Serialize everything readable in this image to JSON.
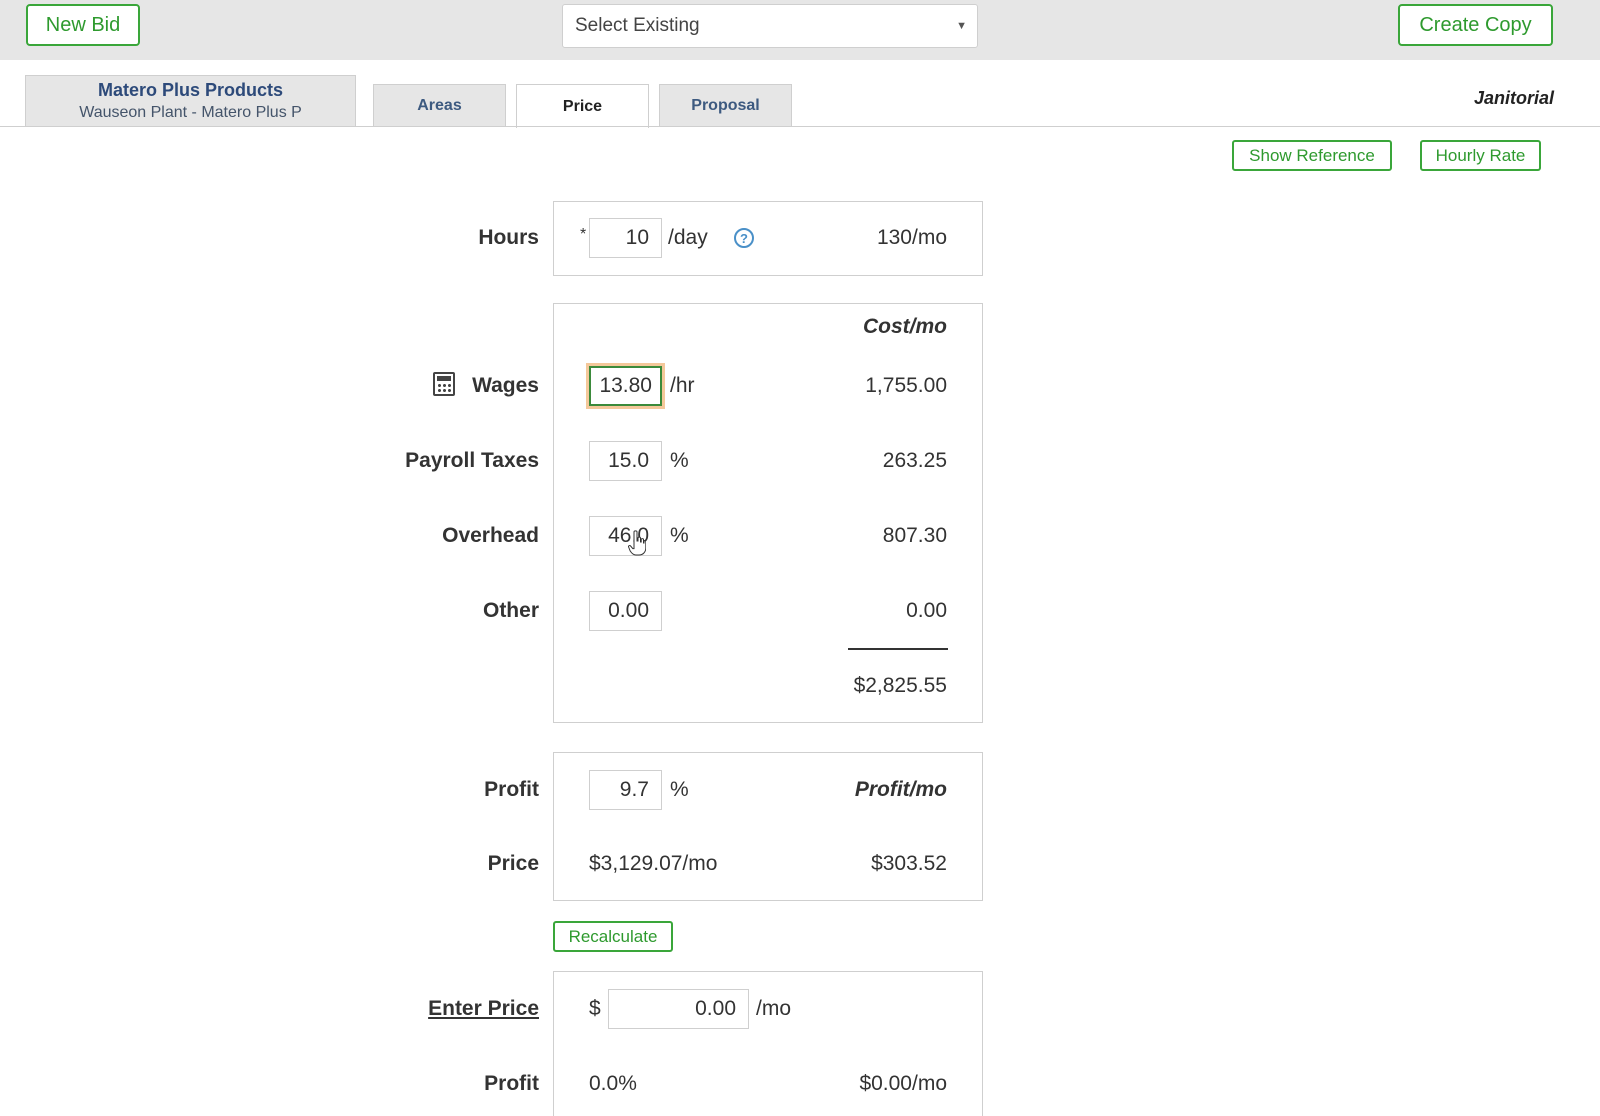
{
  "toolbar": {
    "new_bid": "New Bid",
    "select_existing": "Select Existing",
    "create_copy": "Create Copy"
  },
  "tabs": {
    "company_name": "Matero Plus Products",
    "company_sub": "Wauseon Plant - Matero Plus P",
    "areas": "Areas",
    "price": "Price",
    "proposal": "Proposal",
    "service_type": "Janitorial"
  },
  "actions": {
    "show_reference": "Show Reference",
    "hourly_rate": "Hourly Rate"
  },
  "hours": {
    "label": "Hours",
    "required_mark": "*",
    "value": "10",
    "unit": "/day",
    "help": "?",
    "monthly": "130/mo"
  },
  "costs": {
    "header": "Cost/mo",
    "wages_label": "Wages",
    "wages_value": "13.80",
    "wages_unit": "/hr",
    "wages_cost": "1,755.00",
    "payroll_label": "Payroll Taxes",
    "payroll_value": "15.0",
    "payroll_unit": "%",
    "payroll_cost": "263.25",
    "overhead_label": "Overhead",
    "overhead_value": "46.0",
    "overhead_unit": "%",
    "overhead_cost": "807.30",
    "other_label": "Other",
    "other_value": "0.00",
    "other_cost": "0.00",
    "total": "$2,825.55"
  },
  "profit": {
    "label": "Profit",
    "value": "9.7",
    "unit": "%",
    "header": "Profit/mo",
    "price_label": "Price",
    "price_value": "$3,129.07/mo",
    "profit_value": "$303.52"
  },
  "recalculate": "Recalculate",
  "enter_price": {
    "label": "Enter Price",
    "currency": "$",
    "value": "0.00",
    "unit": "/mo",
    "profit_label": "Profit",
    "profit_pct": "0.0%",
    "profit_mo": "$0.00/mo"
  },
  "colors": {
    "accent_green": "#3aa63a",
    "tab_blue": "#2d4a7a",
    "help_blue": "#4a90c8"
  }
}
